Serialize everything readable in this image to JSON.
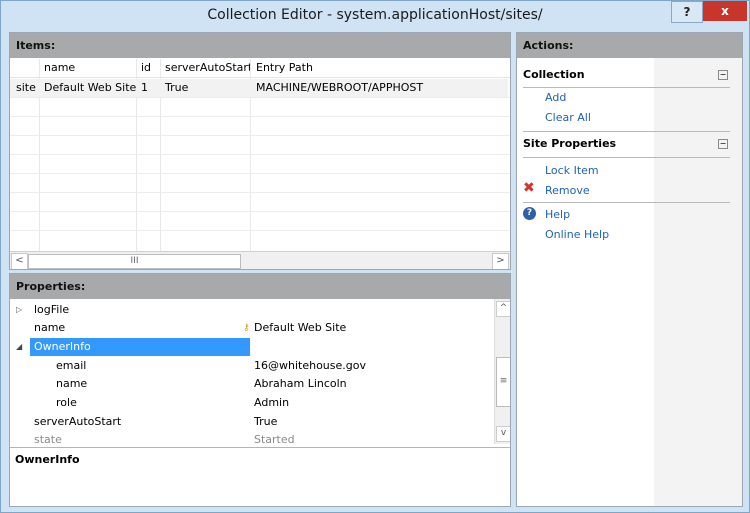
{
  "window": {
    "title": "Collection Editor - system.applicationHost/sites/",
    "help_label": "?",
    "close_label": "x"
  },
  "items": {
    "header": "Items:",
    "columns": [
      "",
      "name",
      "id",
      "serverAutoStart",
      "Entry Path"
    ],
    "rows": [
      [
        "site",
        "Default Web Site",
        "1",
        "True",
        "MACHINE/WEBROOT/APPHOST"
      ]
    ],
    "scroll_left": "<",
    "scroll_right": ">",
    "scroll_thumb": "III"
  },
  "properties": {
    "header": "Properties:",
    "rows": [
      {
        "expander": "▷",
        "name": "logFile",
        "value": ""
      },
      {
        "expander": "",
        "name": "name",
        "value": "Default Web Site",
        "has_key": true
      },
      {
        "expander": "◢",
        "name": "OwnerInfo",
        "value": "",
        "selected": true
      },
      {
        "expander": "",
        "name": "email",
        "value": "16@whitehouse.gov",
        "indent": true
      },
      {
        "expander": "",
        "name": "name",
        "value": "Abraham Lincoln",
        "indent": true
      },
      {
        "expander": "",
        "name": "role",
        "value": "Admin",
        "indent": true
      },
      {
        "expander": "",
        "name": "serverAutoStart",
        "value": "True"
      },
      {
        "expander": "",
        "name": "state",
        "value": "Started",
        "disabled": true
      }
    ],
    "description_title": "OwnerInfo",
    "scroll_up": "^",
    "scroll_down": "v",
    "scroll_thumb": "≡"
  },
  "actions": {
    "header": "Actions:",
    "collection": {
      "title": "Collection",
      "items": [
        "Add",
        "Clear All"
      ]
    },
    "site_properties": {
      "title": "Site Properties",
      "items": [
        "Lock Item",
        "Remove"
      ]
    },
    "help": [
      "Help",
      "Online Help"
    ],
    "collapse_glyph": "−"
  },
  "colors": {
    "link": "#1e62b0",
    "selection": "#3399ff",
    "header_bg": "#a7a9ab",
    "remove_icon": "#d0342c",
    "help_icon": "#2f5fa8"
  }
}
